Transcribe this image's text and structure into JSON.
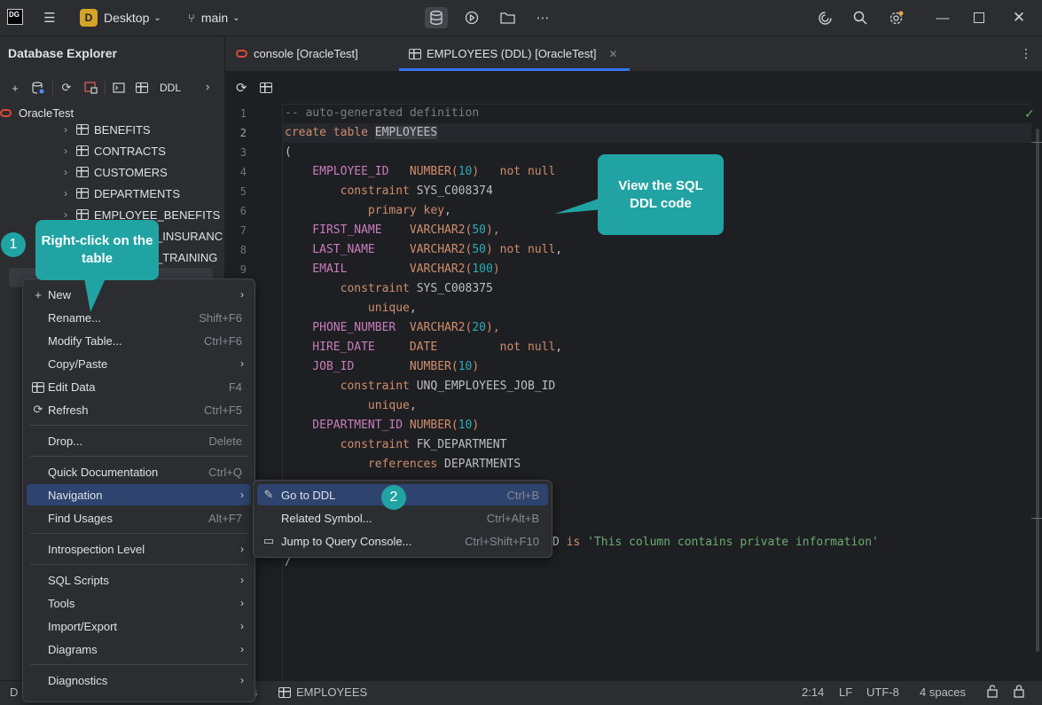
{
  "titlebar": {
    "logo": "DG",
    "project_initial": "D",
    "project": "Desktop",
    "branch": "main",
    "icons": [
      "database-icon",
      "run-icon",
      "folder-icon",
      "more-icon",
      "ai-icon",
      "search-icon",
      "settings-icon"
    ],
    "window_controls": [
      "minimize",
      "maximize",
      "close"
    ]
  },
  "sidebar": {
    "title": "Database Explorer",
    "toolbar": {
      "ddl_label": "DDL"
    },
    "datasource": "OracleTest",
    "tables": [
      "BENEFITS",
      "CONTRACTS",
      "CUSTOMERS",
      "DEPARTMENTS",
      "EMPLOYEE_BENEFITS",
      "_INSURANC",
      "_TRAINING"
    ],
    "bottom_letter": "D"
  },
  "tabs": [
    {
      "label": "console [OracleTest]",
      "active": false
    },
    {
      "label": "EMPLOYEES (DDL) [OracleTest]",
      "active": true
    }
  ],
  "editor": {
    "line_numbers": [
      "1",
      "2",
      "3",
      "4",
      "5",
      "6",
      "7",
      "8",
      "9"
    ],
    "lines": {
      "l1": "-- auto-generated definition",
      "l2a": "create table ",
      "l2b": "EMPLOYEES",
      "l3": "(",
      "l4a": "    EMPLOYEE_ID   ",
      "l4b": "NUMBER(",
      "l4c": "10",
      "l4d": ")   ",
      "l4e": "not null",
      "l5a": "        constraint ",
      "l5b": "SYS_C008374",
      "l6a": "            ",
      "l6b": "primary key",
      "l6c": ",",
      "l7a": "    FIRST_NAME    ",
      "l7b": "VARCHAR2(",
      "l7c": "50",
      "l7d": "),",
      "l8a": "    LAST_NAME     ",
      "l8b": "VARCHAR2(",
      "l8c": "50",
      "l8d": ") ",
      "l8e": "not null",
      "l8f": ",",
      "l9a": "    EMAIL         ",
      "l9b": "VARCHAR2(",
      "l9c": "100",
      "l9d": ")",
      "l10a": "        constraint ",
      "l10b": "SYS_C008375",
      "l11a": "            ",
      "l11b": "unique",
      "l11c": ",",
      "l12a": "    PHONE_NUMBER  ",
      "l12b": "VARCHAR2(",
      "l12c": "20",
      "l12d": "),",
      "l13a": "    HIRE_DATE     ",
      "l13b": "DATE",
      "l13c": "         ",
      "l13d": "not null",
      "l13e": ",",
      "l14a": "    JOB_ID        ",
      "l14b": "NUMBER(",
      "l14c": "10",
      "l14d": ")",
      "l15a": "        constraint ",
      "l15b": "UNQ_EMPLOYEES_JOB_ID",
      "l16a": "            ",
      "l16b": "unique",
      "l16c": ",",
      "l17a": "    DEPARTMENT_ID ",
      "l17b": "NUMBER(",
      "l17c": "10",
      "l17d": ")",
      "l18a": "        constraint ",
      "l18b": "FK_DEPARTMENT",
      "l19a": "            ",
      "l19b": "references ",
      "l19c": "DEPARTMENTS",
      "l23a": "D ",
      "l23b": "is ",
      "l23c": "'This column contains private information'",
      "l24": "/"
    }
  },
  "context_menu": {
    "items": [
      {
        "label": "New",
        "submenu": true,
        "icon": "plus-icon"
      },
      {
        "label": "Rename...",
        "shortcut": "Shift+F6"
      },
      {
        "label": "Modify Table...",
        "shortcut": "Ctrl+F6"
      },
      {
        "label": "Copy/Paste",
        "submenu": true
      },
      {
        "label": "Edit Data",
        "shortcut": "F4",
        "icon": "table-icon"
      },
      {
        "label": "Refresh",
        "shortcut": "Ctrl+F5",
        "icon": "refresh-icon"
      },
      {
        "label": "Drop...",
        "shortcut": "Delete"
      },
      {
        "label": "Quick Documentation",
        "shortcut": "Ctrl+Q"
      },
      {
        "label": "Navigation",
        "submenu": true,
        "selected": true
      },
      {
        "label": "Find Usages",
        "shortcut": "Alt+F7"
      },
      {
        "label": "Introspection Level",
        "submenu": true
      },
      {
        "label": "SQL Scripts",
        "submenu": true
      },
      {
        "label": "Tools",
        "submenu": true
      },
      {
        "label": "Import/Export",
        "submenu": true
      },
      {
        "label": "Diagrams",
        "submenu": true
      },
      {
        "label": "Diagnostics",
        "submenu": true
      }
    ]
  },
  "submenu": {
    "items": [
      {
        "label": "Go to DDL",
        "shortcut": "Ctrl+B",
        "icon": "pencil-icon",
        "selected": true
      },
      {
        "label": "Related Symbol...",
        "shortcut": "Ctrl+Alt+B"
      },
      {
        "label": "Jump to Query Console...",
        "shortcut": "Ctrl+Shift+F10",
        "icon": "console-icon"
      }
    ]
  },
  "callouts": {
    "step1_number": "1",
    "step1_text": "Right-click on the table",
    "step2_number": "2",
    "ddl_text": "View the SQL DDL code"
  },
  "statusbar": {
    "left_letter": "D",
    "crumb_sep": "s",
    "breadcrumb": "EMPLOYEES",
    "position": "2:14",
    "line_ending": "LF",
    "encoding": "UTF-8",
    "indent": "4 spaces"
  },
  "colors": {
    "accent": "#21a3a3",
    "selection": "#2e436e",
    "tab_underline": "#3574f0"
  }
}
